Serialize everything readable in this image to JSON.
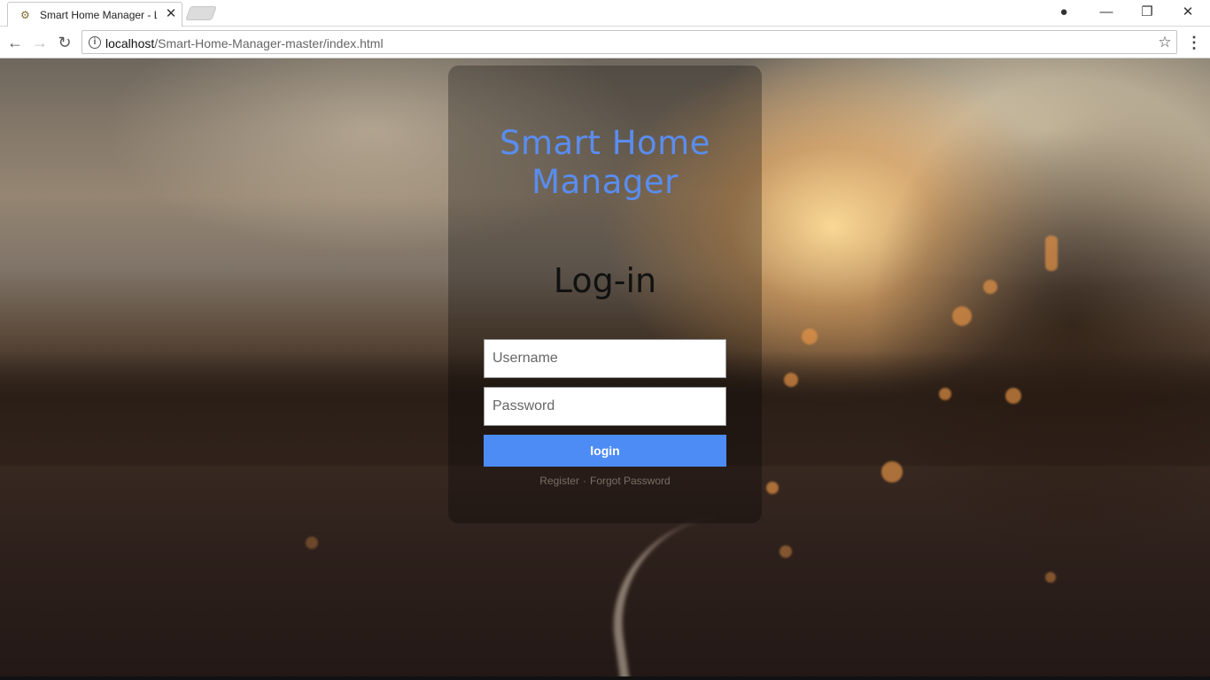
{
  "browser": {
    "tab_title": "Smart Home Manager - Login",
    "tab_favicon": "house-icon",
    "url_host": "localhost",
    "url_path": "/Smart-Home-Manager-master/index.html",
    "icons": {
      "back": "back-arrow-icon",
      "forward": "forward-arrow-icon",
      "reload": "reload-icon",
      "info": "info-icon",
      "bookmark": "star-icon",
      "menu": "kebab-menu-icon",
      "account": "account-icon",
      "minimize": "minimize-icon",
      "maximize": "restore-icon",
      "close": "close-icon"
    }
  },
  "login": {
    "app_title_line1": "Smart Home",
    "app_title_line2": "Manager",
    "heading": "Log-in",
    "username_placeholder": "Username",
    "password_placeholder": "Password",
    "button_label": "login",
    "register_link": "Register",
    "separator": "·",
    "forgot_link": "Forgot Password"
  },
  "colors": {
    "accent": "#4d8cf5",
    "title": "#5a8df0"
  }
}
